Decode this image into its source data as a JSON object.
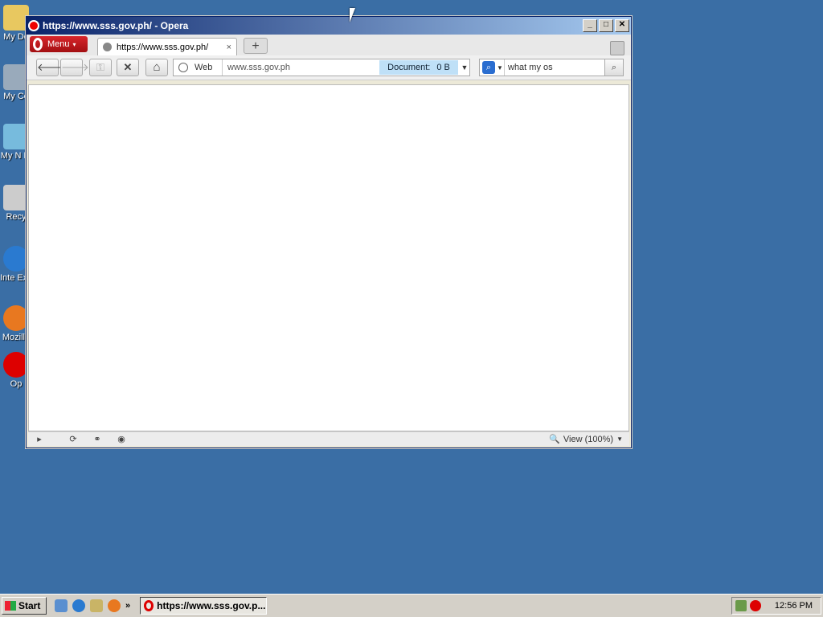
{
  "desktop": {
    "icons": [
      {
        "label": "My Do",
        "icon": "documents-icon",
        "color": "#e8c860"
      },
      {
        "label": "My Co",
        "icon": "computer-icon",
        "color": "#9ab"
      },
      {
        "label": "My N Pl",
        "icon": "network-icon",
        "color": "#7bd"
      },
      {
        "label": "Recy",
        "icon": "recycle-bin-icon",
        "color": "#ccc"
      },
      {
        "label": "Inte Exp",
        "icon": "ie-icon",
        "color": "#2a7ad0"
      },
      {
        "label": "Mozilla",
        "icon": "firefox-icon",
        "color": "#e87820"
      },
      {
        "label": "Op",
        "icon": "opera-icon",
        "color": "#d00"
      }
    ]
  },
  "window": {
    "title": "https://www.sss.gov.ph/ - Opera",
    "buttons": {
      "minimize": "_",
      "maximize": "□",
      "close": "✕"
    }
  },
  "tabbar": {
    "menu_label": "Menu",
    "tab_title": "https://www.sss.gov.ph/",
    "tab_close": "×",
    "new_tab": "+"
  },
  "toolbar": {
    "back": "🡐",
    "forward": "🡒",
    "key": "⚿",
    "stop": "✕",
    "home": "⌂",
    "web_label": "Web",
    "url": "www.sss.gov.ph",
    "document_label": "Document:",
    "document_size": "0 B",
    "search_text": "what my os"
  },
  "statusbar": {
    "view_label": "View (100%)"
  },
  "taskbar": {
    "start_label": "Start",
    "task_title": "https://www.sss.gov.p...",
    "clock": "12:56 PM"
  }
}
